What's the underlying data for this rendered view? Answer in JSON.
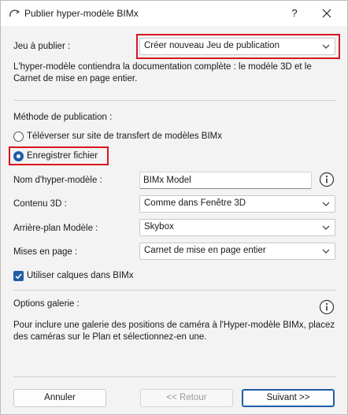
{
  "window": {
    "title": "Publier hyper-modèle BIMx",
    "help_label": "?"
  },
  "publish_set": {
    "label": "Jeu à publier :",
    "value": "Créer nouveau Jeu de publication",
    "description": "L'hyper-modèle contiendra la documentation complète : le modèle 3D et le Carnet de mise en page entier."
  },
  "method": {
    "label": "Méthode de publication :",
    "options": [
      {
        "label": "Téléverser sur site de transfert de modèles BIMx",
        "selected": false
      },
      {
        "label": "Enregistrer fichier",
        "selected": true
      }
    ]
  },
  "fields": {
    "name_label": "Nom d'hyper-modèle :",
    "name_value": "BIMx Model",
    "content3d_label": "Contenu 3D :",
    "content3d_value": "Comme dans Fenêtre 3D",
    "background_label": "Arrière-plan Modèle :",
    "background_value": "Skybox",
    "layouts_label": "Mises en page :",
    "layouts_value": "Carnet de mise en page entier"
  },
  "layers_checkbox": {
    "label": "Utiliser calques dans BIMx",
    "checked": true
  },
  "gallery": {
    "label": "Options galerie :",
    "description": "Pour inclure une galerie des positions de caméra à l'Hyper-modèle BIMx, placez des caméras sur le Plan et sélectionnez-en une."
  },
  "buttons": {
    "cancel": "Annuler",
    "back": "<< Retour",
    "next": "Suivant >>"
  },
  "colors": {
    "accent": "#1f5ca8",
    "highlight": "#d8151e",
    "background": "#f3f3f3"
  },
  "icons": {
    "app": "bimx-publish-icon",
    "close": "close-icon",
    "info": "info-icon",
    "dropdown": "chevron-down-icon",
    "check": "checkmark-icon"
  }
}
